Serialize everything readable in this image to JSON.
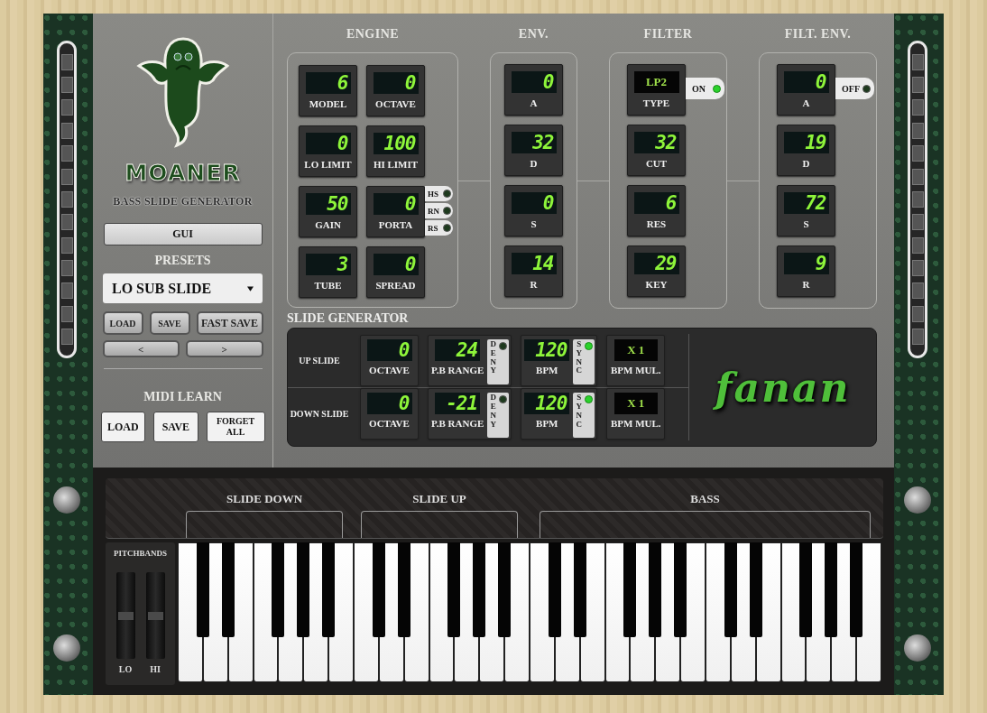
{
  "logo": {
    "name": "MOANER",
    "subtitle": "BASS SLIDE GENERATOR"
  },
  "gui_button": "GUI",
  "presets": {
    "title": "PRESETS",
    "selected": "LO SUB SLIDE",
    "buttons": [
      "LOAD",
      "SAVE",
      "FAST SAVE"
    ],
    "nav": [
      "<",
      ">"
    ]
  },
  "midi_learn": {
    "title": "MIDI LEARN",
    "buttons": [
      "LOAD",
      "SAVE",
      "FORGET ALL"
    ]
  },
  "engine": {
    "title": "ENGINE",
    "controls": [
      {
        "kind": "digits",
        "label": "MODEL",
        "value": "6"
      },
      {
        "kind": "digits",
        "label": "OCTAVE",
        "value": "0"
      },
      {
        "kind": "digits",
        "label": "LO LIMIT",
        "value": "0"
      },
      {
        "kind": "digits",
        "label": "HI LIMIT",
        "value": "100"
      },
      {
        "kind": "digits",
        "label": "GAIN",
        "value": "50"
      },
      {
        "kind": "digits",
        "label": "PORTA",
        "value": "0"
      },
      {
        "kind": "digits",
        "label": "TUBE",
        "value": "3"
      },
      {
        "kind": "digits",
        "label": "SPREAD",
        "value": "0"
      }
    ],
    "switches": [
      {
        "label": "HS",
        "on": false
      },
      {
        "label": "RN",
        "on": false
      },
      {
        "label": "RS",
        "on": false
      }
    ]
  },
  "env": {
    "title": "ENV.",
    "controls": [
      {
        "kind": "digits",
        "label": "A",
        "value": "0"
      },
      {
        "kind": "digits",
        "label": "D",
        "value": "32"
      },
      {
        "kind": "digits",
        "label": "S",
        "value": "0"
      },
      {
        "kind": "digits",
        "label": "R",
        "value": "14"
      }
    ]
  },
  "filter": {
    "title": "FILTER",
    "toggle": {
      "label": "ON",
      "on": true
    },
    "controls": [
      {
        "kind": "text",
        "label": "TYPE",
        "value": "LP2"
      },
      {
        "kind": "digits",
        "label": "CUT",
        "value": "32"
      },
      {
        "kind": "digits",
        "label": "RES",
        "value": "6"
      },
      {
        "kind": "digits",
        "label": "KEY",
        "value": "29"
      }
    ]
  },
  "filt_env": {
    "title": "FILT. ENV.",
    "toggle": {
      "label": "OFF",
      "on": false
    },
    "controls": [
      {
        "kind": "digits",
        "label": "A",
        "value": "0"
      },
      {
        "kind": "digits",
        "label": "D",
        "value": "19"
      },
      {
        "kind": "digits",
        "label": "S",
        "value": "72"
      },
      {
        "kind": "digits",
        "label": "R",
        "value": "9"
      }
    ]
  },
  "slide_generator": {
    "title": "SLIDE GENERATOR",
    "brand": "fanan",
    "rows": [
      {
        "label": "UP SLIDE",
        "cells": [
          {
            "kind": "digits",
            "label": "OCTAVE",
            "value": "0"
          },
          {
            "kind": "digits",
            "label": "P.B RANGE",
            "value": "24",
            "switch": {
              "label": "DENY",
              "on": false
            }
          },
          {
            "kind": "digits",
            "label": "BPM",
            "value": "120",
            "switch": {
              "label": "SYNC",
              "on": true
            }
          },
          {
            "kind": "text",
            "label": "BPM MUL.",
            "value": "X 1"
          }
        ]
      },
      {
        "label": "DOWN SLIDE",
        "cells": [
          {
            "kind": "digits",
            "label": "OCTAVE",
            "value": "0"
          },
          {
            "kind": "digits",
            "label": "P.B RANGE",
            "value": "-21",
            "switch": {
              "label": "DENY",
              "on": false
            }
          },
          {
            "kind": "digits",
            "label": "BPM",
            "value": "120",
            "switch": {
              "label": "SYNC",
              "on": true
            }
          },
          {
            "kind": "text",
            "label": "BPM MUL.",
            "value": "X 1"
          }
        ]
      }
    ]
  },
  "keyboard": {
    "zones": [
      {
        "label": "SLIDE DOWN"
      },
      {
        "label": "SLIDE UP"
      },
      {
        "label": "BASS"
      }
    ],
    "pitchbands": {
      "title": "PITCHBANDS",
      "wheels": [
        "LO",
        "HI"
      ]
    }
  }
}
